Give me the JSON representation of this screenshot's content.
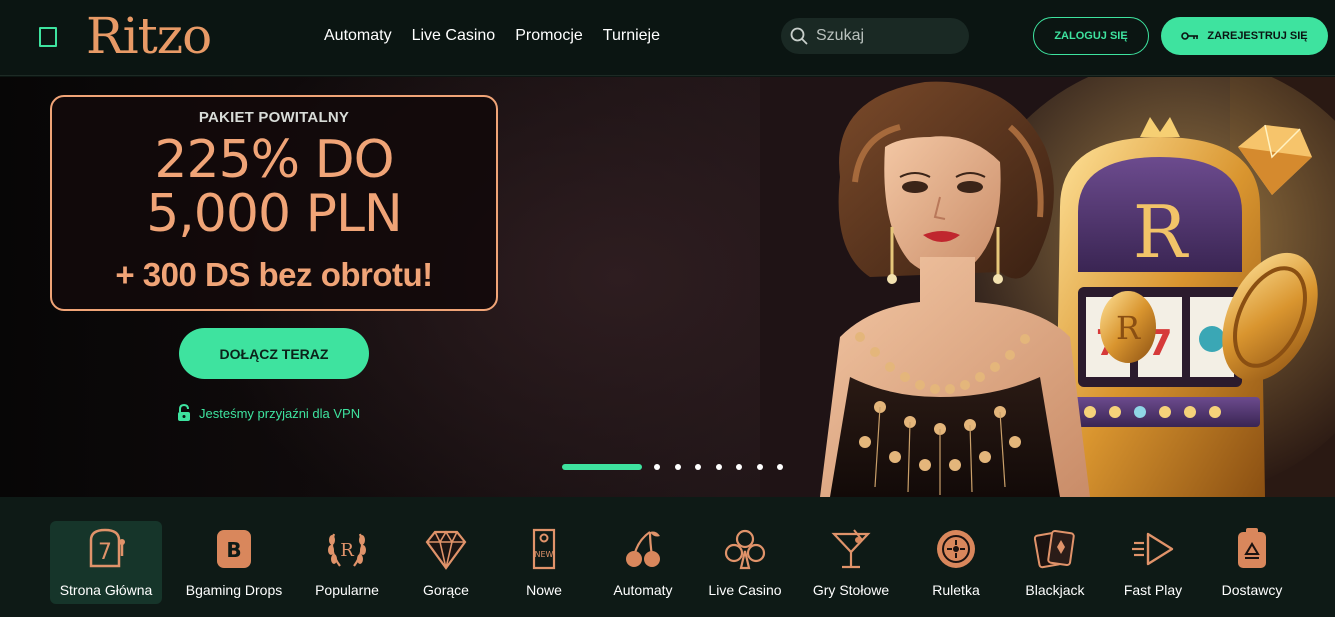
{
  "header": {
    "logo": "Ritzo",
    "nav": [
      "Automaty",
      "Live Casino",
      "Promocje",
      "Turnieje"
    ],
    "search_placeholder": "Szukaj",
    "login_label": "ZALOGUJ SIĘ",
    "register_label": "ZAREJESTRUJ SIĘ"
  },
  "hero": {
    "eyebrow": "PAKIET POWITALNY",
    "headline_1": "225% DO",
    "headline_2": "5,000 PLN",
    "headline_3": "+ 300 DS bez obrotu!",
    "cta_label": "DOŁĄCZ TERAZ",
    "vpn_text": "Jesteśmy przyjaźni dla VPN",
    "slides_total": 8,
    "slide_active": 1
  },
  "categories": [
    {
      "label": "Strona Główna",
      "icon": "slot-seven-icon",
      "active": true
    },
    {
      "label": "Bgaming Drops",
      "icon": "b-badge-icon",
      "active": false
    },
    {
      "label": "Popularne",
      "icon": "laurel-icon",
      "active": false
    },
    {
      "label": "Gorące",
      "icon": "diamond-icon",
      "active": false
    },
    {
      "label": "Nowe",
      "icon": "new-tag-icon",
      "active": false
    },
    {
      "label": "Automaty",
      "icon": "cherries-icon",
      "active": false
    },
    {
      "label": "Live Casino",
      "icon": "club-icon",
      "active": false
    },
    {
      "label": "Gry Stołowe",
      "icon": "cocktail-icon",
      "active": false
    },
    {
      "label": "Ruletka",
      "icon": "roulette-icon",
      "active": false
    },
    {
      "label": "Blackjack",
      "icon": "cards-icon",
      "active": false
    },
    {
      "label": "Fast Play",
      "icon": "fast-play-icon",
      "active": false
    },
    {
      "label": "Dostawcy",
      "icon": "provider-icon",
      "active": false
    }
  ],
  "colors": {
    "accent": "#3ee39f",
    "promo": "#f0a477",
    "background": "#0c1612"
  }
}
